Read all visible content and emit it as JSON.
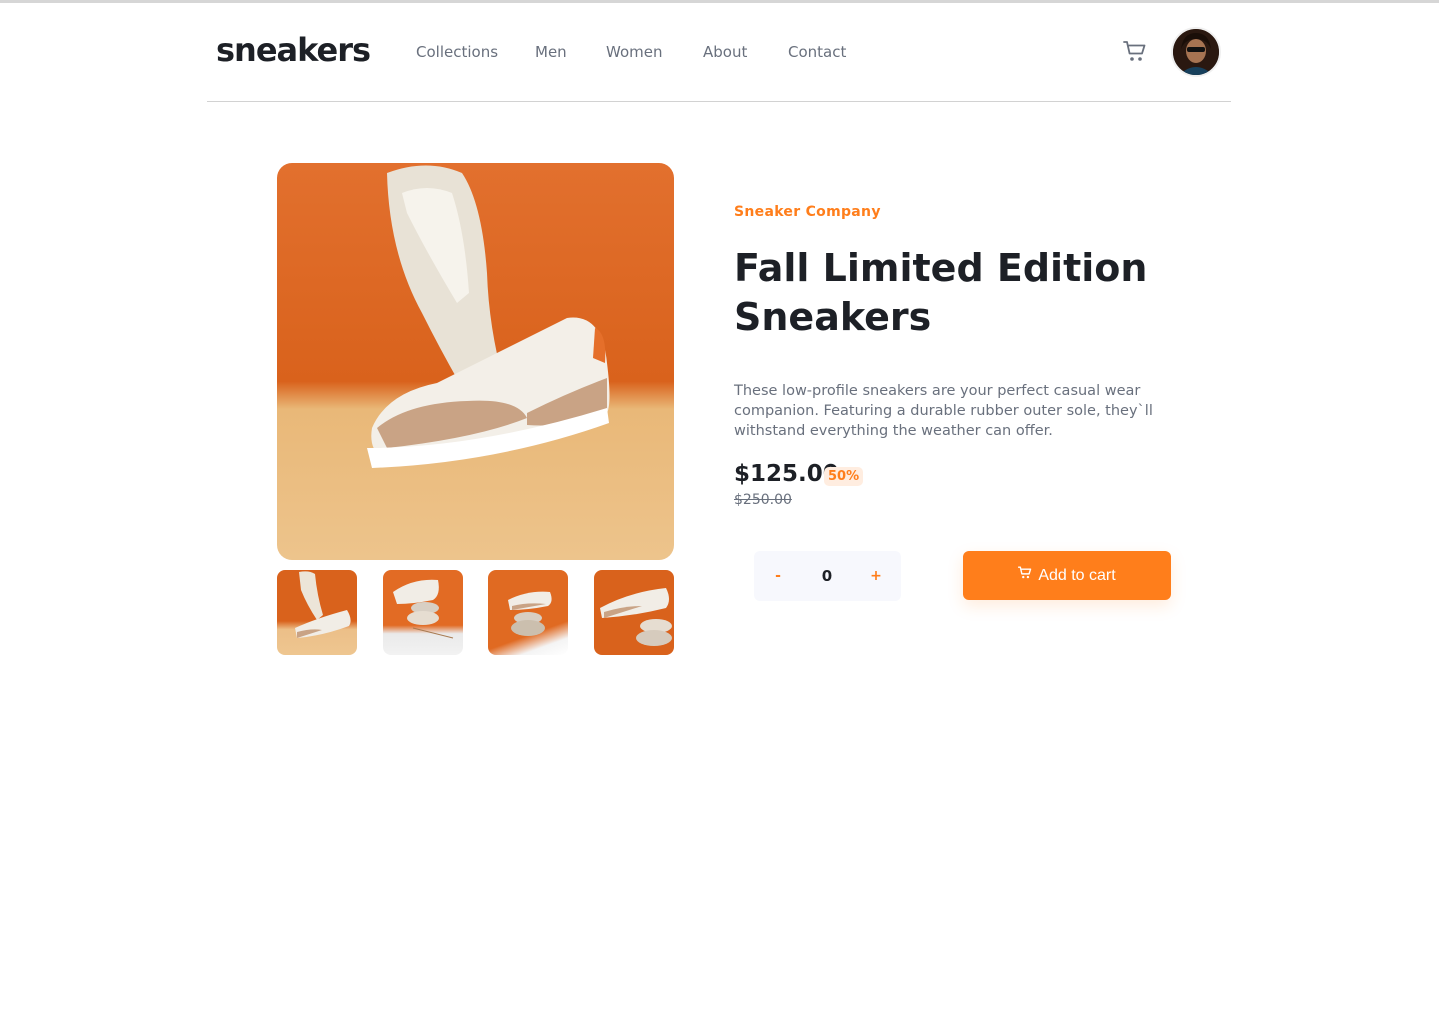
{
  "brand": {
    "logo": "sneakers"
  },
  "nav": {
    "items": [
      "Collections",
      "Men",
      "Women",
      "About",
      "Contact"
    ]
  },
  "header_icons": {
    "cart": "cart-icon",
    "avatar": "user-avatar"
  },
  "product": {
    "company": "Sneaker Company",
    "title": "Fall Limited Edition Sneakers",
    "description": "These low-profile sneakers are your perfect casual wear companion. Featuring a durable rubber outer sole, they`ll withstand everything the weather can offer.",
    "price": "$125.00",
    "discount": "50%",
    "old_price": "$250.00",
    "quantity": "0",
    "minus_label": "-",
    "plus_label": "+",
    "add_to_cart_label": "Add to cart"
  },
  "colors": {
    "accent": "#ff7e1b",
    "accent_light": "#ffede0",
    "text_dark": "#1d2026",
    "text_muted": "#69707d"
  }
}
